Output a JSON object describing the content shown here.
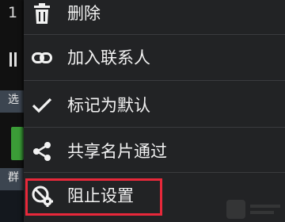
{
  "background": {
    "partial_title_char": "1",
    "band_1_char": "选",
    "band_2_char": "群"
  },
  "menu": {
    "items": [
      {
        "label": "删除",
        "icon": "trash-icon"
      },
      {
        "label": "加入联系人",
        "icon": "link-icon"
      },
      {
        "label": "标记为默认",
        "icon": "checkmark-icon"
      },
      {
        "label": "共享名片通过",
        "icon": "share-icon"
      },
      {
        "label": "阻止设置",
        "icon": "block-settings-icon",
        "highlighted": true
      }
    ]
  },
  "colors": {
    "menu_background": "#222325",
    "highlight_border": "#e8283a",
    "text": "#f2f2f2",
    "background_band": "#3c4550"
  }
}
